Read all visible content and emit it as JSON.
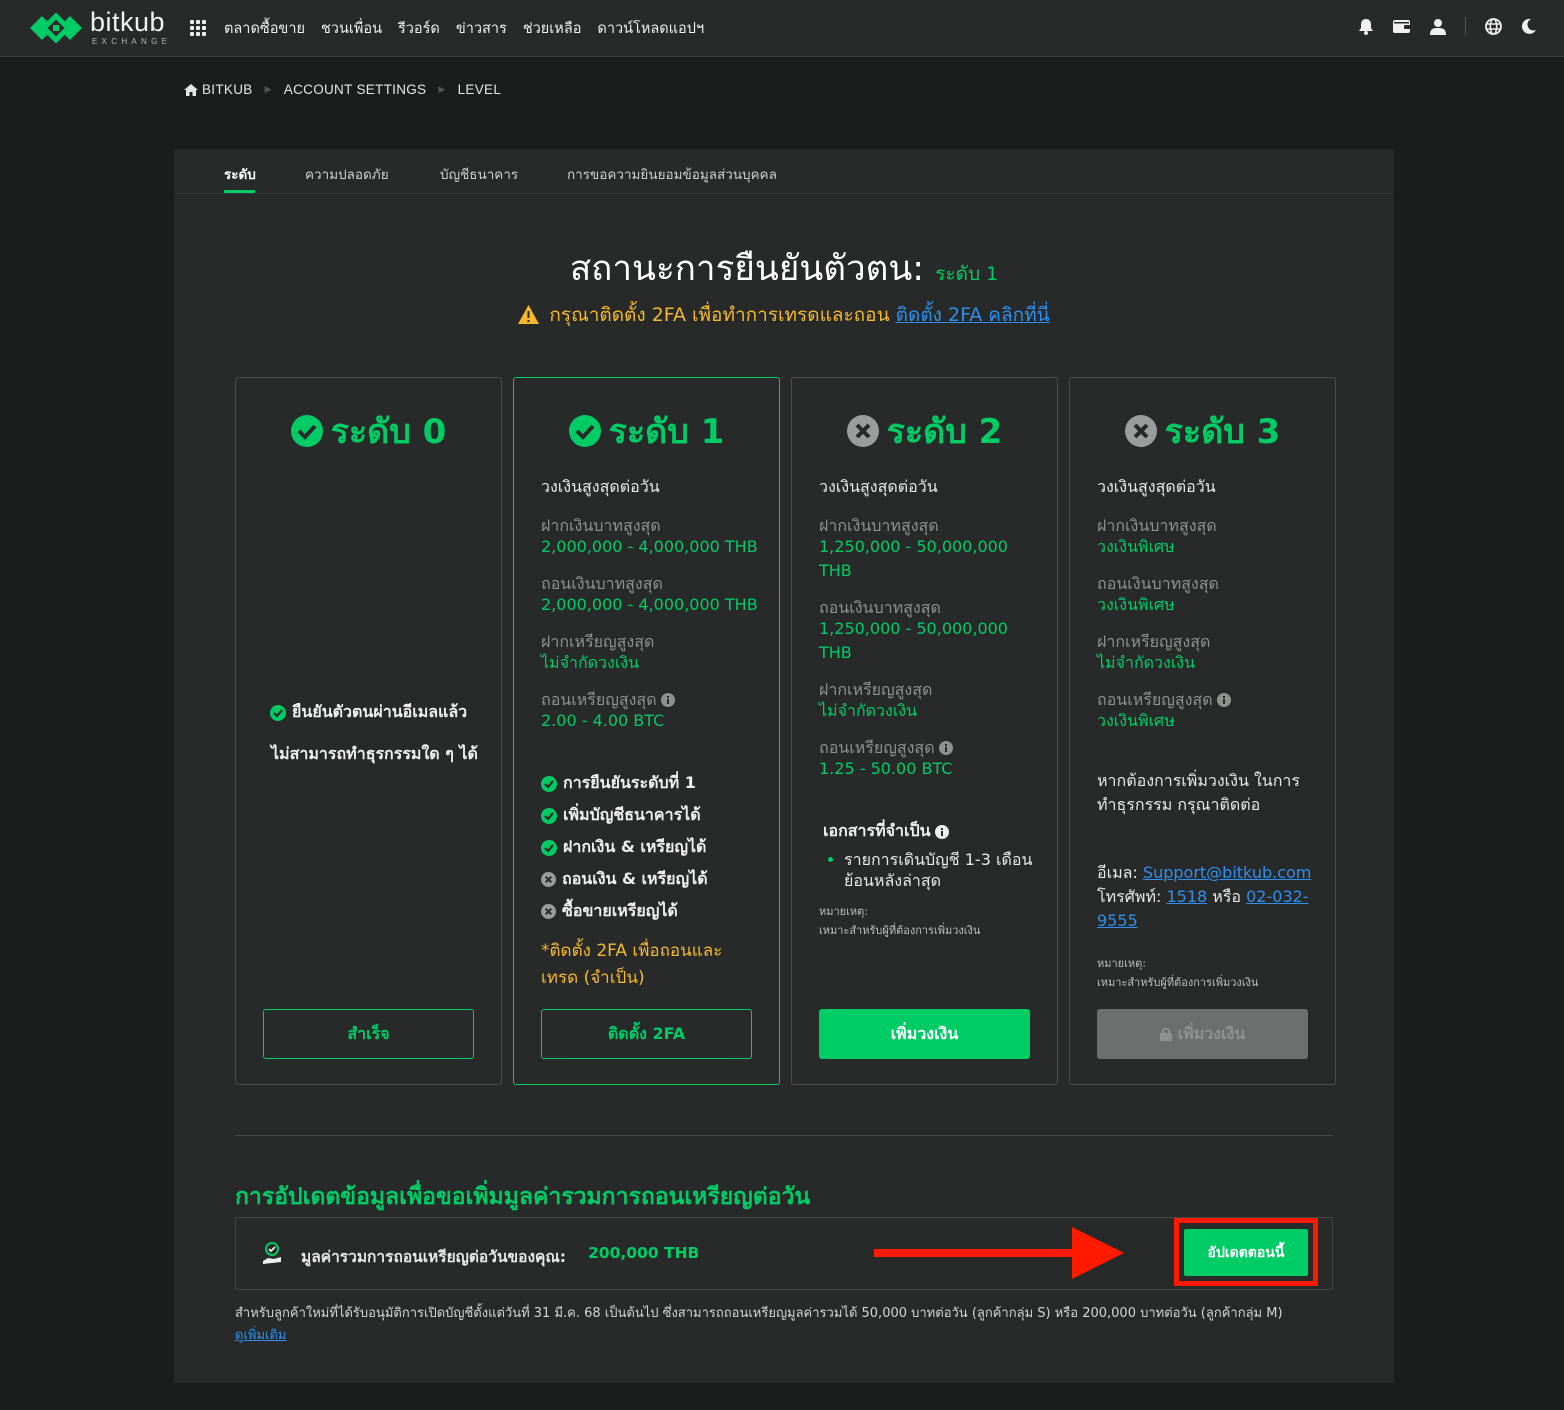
{
  "brand": {
    "name": "bitkub",
    "sub": "EXCHANGE",
    "color": "#00cc66"
  },
  "nav": {
    "items": [
      "ตลาดซื้อขาย",
      "ชวนเพื่อน",
      "รีวอร์ด",
      "ข่าวสาร",
      "ช่วยเหลือ",
      "ดาวน์โหลดแอปฯ"
    ],
    "right_icons": [
      "bell-icon",
      "wallet-icon",
      "user-icon",
      "globe-icon",
      "moon-icon"
    ]
  },
  "breadcrumb": [
    "BITKUB",
    "ACCOUNT SETTINGS",
    "LEVEL"
  ],
  "tabs": [
    "ระดับ",
    "ความปลอดภัย",
    "บัญชีธนาคาร",
    "การขอความยินยอมข้อมูลส่วนบุคคล"
  ],
  "status": {
    "title": "สถานะการยืนยันตัวตน:",
    "level": "ระดับ 1",
    "warning": "กรุณาติดตั้ง 2FA เพื่อทำการเทรดและถอน",
    "warning_link": "ติดตั้ง 2FA คลิกที่นี่"
  },
  "levels": [
    {
      "title": "ระดับ 0",
      "checks": [
        "ยืนยันตัวตนผ่านอีเมลแล้ว"
      ],
      "note": "ไม่สามารถทำธุรกรรมใด ๆ ได้",
      "button": "สำเร็จ"
    },
    {
      "title": "ระดับ 1",
      "daily": "วงเงินสูงสุดต่อวัน",
      "rows": [
        {
          "label": "ฝากเงินบาทสูงสุด",
          "value": "2,000,000 - 4,000,000 THB"
        },
        {
          "label": "ถอนเงินบาทสูงสุด",
          "value": "2,000,000 - 4,000,000 THB"
        },
        {
          "label": "ฝากเหรียญสูงสุด",
          "value": "ไม่จำกัดวงเงิน"
        },
        {
          "label": "ถอนเหรียญสูงสุด",
          "value": "2.00 - 4.00 BTC"
        }
      ],
      "checks": [
        "การยืนยันระดับที่ 1",
        "เพิ่มบัญชีธนาคารได้",
        "ฝากเงิน & เหรียญได้",
        "ถอนเงิน & เหรียญได้",
        "ซื้อขายเหรียญได้"
      ],
      "twofa_note": "*ติดตั้ง 2FA เพื่อถอนและเทรด (จำเป็น)",
      "button": "ติดตั้ง 2FA"
    },
    {
      "title": "ระดับ 2",
      "daily": "วงเงินสูงสุดต่อวัน",
      "rows": [
        {
          "label": "ฝากเงินบาทสูงสุด",
          "value": "1,250,000 - 50,000,000 THB"
        },
        {
          "label": "ถอนเงินบาทสูงสุด",
          "value": "1,250,000 - 50,000,000 THB"
        },
        {
          "label": "ฝากเหรียญสูงสุด",
          "value": "ไม่จำกัดวงเงิน"
        },
        {
          "label": "ถอนเหรียญสูงสุด",
          "value": "1.25 - 50.00 BTC"
        }
      ],
      "docs_title": "เอกสารที่จำเป็น",
      "docs": [
        "รายการเดินบัญชี 1-3 เดือน ย้อนหลังล่าสุด"
      ],
      "remark_title": "หมายเหตุ:",
      "remark": "เหมาะสำหรับผู้ที่ต้องการเพิ่มวงเงิน",
      "button": "เพิ่มวงเงิน"
    },
    {
      "title": "ระดับ 3",
      "daily": "วงเงินสูงสุดต่อวัน",
      "rows": [
        {
          "label": "ฝากเงินบาทสูงสุด",
          "value": "วงเงินพิเศษ"
        },
        {
          "label": "ถอนเงินบาทสูงสุด",
          "value": "วงเงินพิเศษ"
        },
        {
          "label": "ฝากเหรียญสูงสุด",
          "value": "ไม่จำกัดวงเงิน"
        },
        {
          "label": "ถอนเหรียญสูงสุด",
          "value": "วงเงินพิเศษ"
        }
      ],
      "contact_intro": "หากต้องการเพิ่มวงเงิน ในการทำธุรกรรม กรุณาติดต่อ",
      "email_label": "อีเมล:",
      "email": "Support@bitkub.com",
      "phone_label": "โทรศัพท์:",
      "phone1": "1518",
      "or": "หรือ",
      "phone2": "02-032-9555",
      "remark_title": "หมายเหตุ:",
      "remark": "เหมาะสำหรับผู้ที่ต้องการเพิ่มวงเงิน",
      "button": "เพิ่มวงเงิน"
    }
  ],
  "update": {
    "title": "การอัปเดตข้อมูลเพื่อขอเพิ่มมูลค่ารวมการถอนเหรียญต่อวัน",
    "label": "มูลค่ารวมการถอนเหรียญต่อวันของคุณ:",
    "value": "200,000 THB",
    "button": "อัปเดตตอนนี้",
    "footnote": "สำหรับลูกค้าใหม่ที่ได้รับอนุมัติการเปิดบัญชีตั้งแต่วันที่ 31 มี.ค. 68 เป็นต้นไป ซึ่งสามารถถอนเหรียญมูลค่ารวมได้ 50,000 บาทต่อวัน (ลูกค้ากลุ่ม S) หรือ 200,000 บาทต่อวัน (ลูกค้ากลุ่ม M)",
    "more": "ดูเพิ่มเติม"
  },
  "colors": {
    "accent": "#00cc66",
    "warning": "#f5b82e",
    "link": "#2e8ff0",
    "highlight": "#ff1a00"
  }
}
